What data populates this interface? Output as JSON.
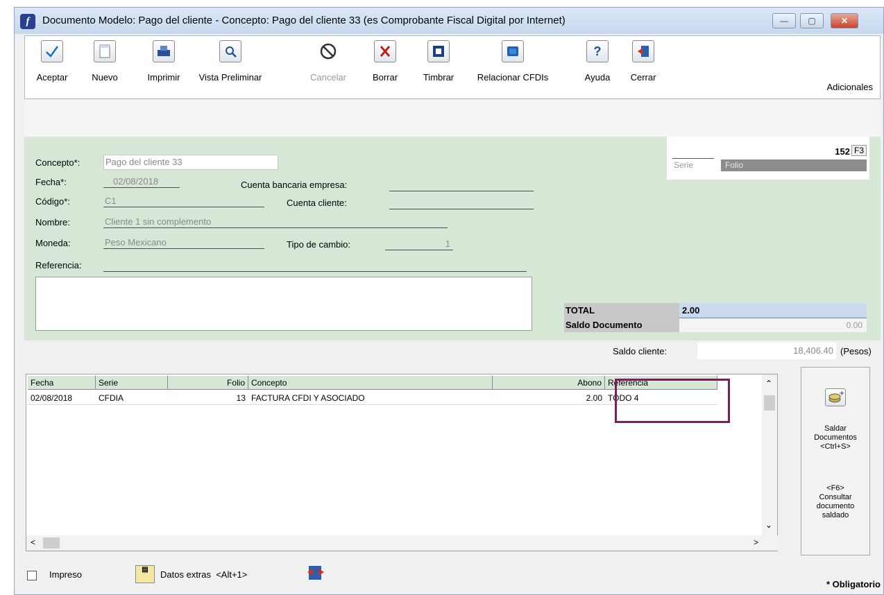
{
  "window": {
    "title": "Documento Modelo: Pago del cliente - Concepto: Pago del cliente 33 (es Comprobante Fiscal Digital por Internet)",
    "minimize": "—",
    "maximize": "▢",
    "close": "✕"
  },
  "toolbar": {
    "aceptar": "Aceptar",
    "nuevo": "Nuevo",
    "imprimir": "Imprimir",
    "vista_preliminar": "Vista Preliminar",
    "cancelar": "Cancelar",
    "borrar": "Borrar",
    "timbrar": "Timbrar",
    "relacionar": "Relacionar CFDIs",
    "ayuda": "Ayuda",
    "cerrar": "Cerrar",
    "adicionales": "Adicionales"
  },
  "form": {
    "concepto_label": "Concepto*:",
    "concepto_value": "Pago del cliente 33",
    "fecha_label": "Fecha*:",
    "fecha_value": "02/08/2018",
    "codigo_label": "Código*:",
    "codigo_value": "C1",
    "nombre_label": "Nombre:",
    "nombre_value": "Cliente 1 sin complemento",
    "moneda_label": "Moneda:",
    "moneda_value": "Peso Mexicano",
    "referencia_label": "Referencia:",
    "cuenta_bancaria_label": "Cuenta bancaria empresa:",
    "cuenta_cliente_label": "Cuenta cliente:",
    "tipo_cambio_label": "Tipo de cambio:",
    "tipo_cambio_value": "1"
  },
  "folio_box": {
    "folio_number": "152",
    "f3": "F3",
    "serie_label": "Serie",
    "folio_label": "Folio"
  },
  "totals": {
    "total_label": "TOTAL",
    "total_value": "2.00",
    "saldo_documento_label": "Saldo Documento",
    "saldo_documento_value": "0.00",
    "saldo_cliente_label": "Saldo cliente:",
    "saldo_cliente_value": "18,406.40",
    "currency": "(Pesos)"
  },
  "table": {
    "headers": [
      "Fecha",
      "Serie",
      "Folio",
      "Concepto",
      "Abono",
      "Referencia"
    ],
    "rows": [
      [
        "02/08/2018",
        "CFDIA",
        "13",
        "FACTURA CFDI Y ASOCIADO",
        "2.00",
        "TODO 4"
      ]
    ]
  },
  "side_panel": {
    "saldar_line1": "Saldar",
    "saldar_line2": "Documentos",
    "saldar_line3": "<Ctrl+S>",
    "consultar_line1": "<F6>",
    "consultar_line2": "Consultar",
    "consultar_line3": "documento",
    "consultar_line4": "saldado"
  },
  "footer": {
    "impreso": "Impreso",
    "datos_extras": "Datos extras  <Alt+1>",
    "obligatorio": "* Obligatorio"
  },
  "colors": {
    "form_background": "#d7e7d6",
    "highlight_border": "#7a1f5c",
    "total_bar": "#c9d9f0"
  }
}
